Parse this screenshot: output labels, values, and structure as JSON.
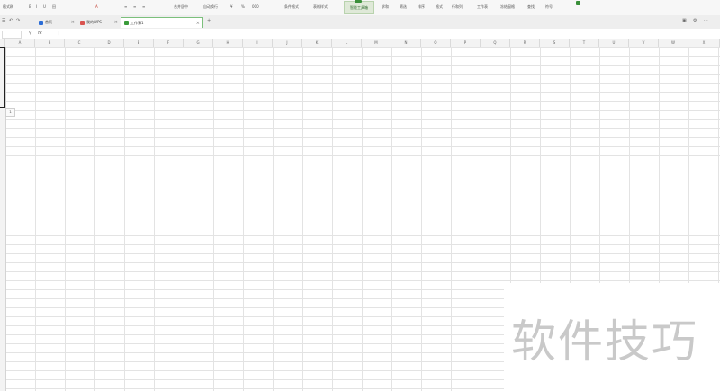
{
  "ribbon": {
    "items": [
      "格式刷",
      "B",
      "I",
      "U",
      "田",
      "A",
      "≡",
      "≡",
      "≡",
      "合并居中",
      "自动换行",
      "¥",
      "%",
      "000",
      "条件格式",
      "表格样式",
      "求和",
      "筛选",
      "排序",
      "格式",
      "行和列",
      "工作表",
      "冻结窗格",
      "查找",
      "符号"
    ],
    "active_button": "智能工具箱"
  },
  "tabs": [
    {
      "label": "首页",
      "color": "#2b6cd6"
    },
    {
      "label": "我的WPS",
      "color": "#d9534f"
    },
    {
      "label": "工作簿1",
      "color": "#3a9b3a"
    }
  ],
  "formula": {
    "name_value": "",
    "fx_label": "fx",
    "search_icon": "search-icon"
  },
  "columns": [
    "A",
    "B",
    "C",
    "D",
    "E",
    "F",
    "G",
    "H",
    "I",
    "J",
    "K",
    "L",
    "M",
    "N",
    "O",
    "P",
    "Q",
    "R",
    "S",
    "T",
    "U",
    "V",
    "W",
    "X"
  ],
  "row_marker": "1",
  "watermark": "软件技巧",
  "colors": {
    "accent": "#3a8f3a",
    "active_tab_border": "#7cc07c",
    "grid": "#e3e3e3"
  }
}
